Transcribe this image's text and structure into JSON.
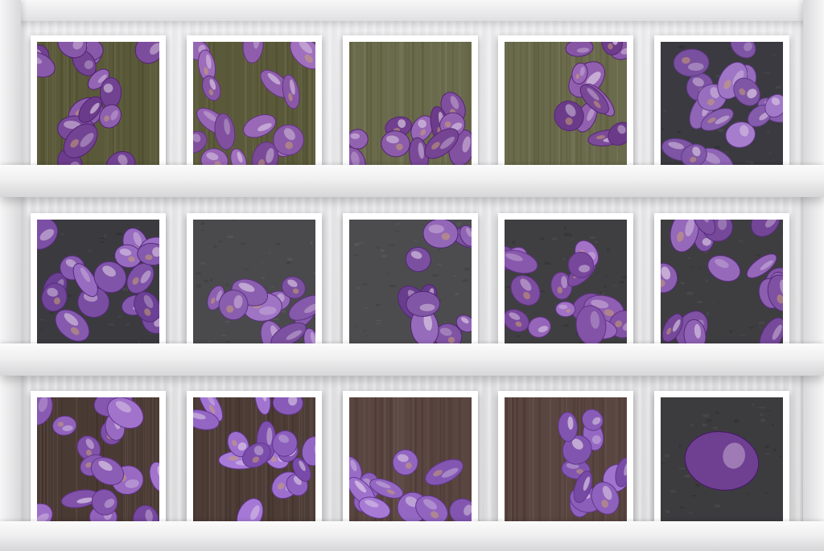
{
  "scene": {
    "description_visible_text": "",
    "shelf_color": "#ececee",
    "rows": [
      {
        "tiles": [
          {
            "background": "wood-olive",
            "bg_color": "#5a5a3a",
            "gem_color": "#7a4a9a",
            "layout": "full"
          },
          {
            "background": "wood-olive",
            "bg_color": "#5a5a3a",
            "gem_color": "#8a5aa8",
            "layout": "full"
          },
          {
            "background": "wood-olive",
            "bg_color": "#6a6a4c",
            "gem_color": "#7d4d9c",
            "layout": "bottom"
          },
          {
            "background": "wood-olive",
            "bg_color": "#6a6a4c",
            "gem_color": "#7d4d9c",
            "layout": "right"
          },
          {
            "background": "stone-dark",
            "bg_color": "#3a3a40",
            "gem_color": "#8a60b0",
            "layout": "full"
          }
        ]
      },
      {
        "tiles": [
          {
            "background": "stone-dark",
            "bg_color": "#3b3b3f",
            "gem_color": "#7e52a6",
            "layout": "full"
          },
          {
            "background": "slate-grey",
            "bg_color": "#4a4a4c",
            "gem_color": "#8458a8",
            "layout": "bottom"
          },
          {
            "background": "slate-grey",
            "bg_color": "#4c4c4e",
            "gem_color": "#7a4e9e",
            "layout": "right"
          },
          {
            "background": "slate-grey",
            "bg_color": "#3f3f42",
            "gem_color": "#8a5aae",
            "layout": "full"
          },
          {
            "background": "slate-grey",
            "bg_color": "#3e3e41",
            "gem_color": "#7f52a4",
            "layout": "full"
          }
        ]
      },
      {
        "tiles": [
          {
            "background": "wood-brown",
            "bg_color": "#4a3a34",
            "gem_color": "#8a5cb4",
            "layout": "full"
          },
          {
            "background": "wood-brown",
            "bg_color": "#4d3c36",
            "gem_color": "#8c5ebc",
            "layout": "full"
          },
          {
            "background": "wood-brown",
            "bg_color": "#5a4640",
            "gem_color": "#8a5eb8",
            "layout": "bottom"
          },
          {
            "background": "wood-brown",
            "bg_color": "#5a4640",
            "gem_color": "#8a5eb8",
            "layout": "right"
          },
          {
            "background": "slate-grey",
            "bg_color": "#3c3c3f",
            "gem_color": "#6e3e90",
            "layout": "single"
          }
        ]
      }
    ]
  }
}
